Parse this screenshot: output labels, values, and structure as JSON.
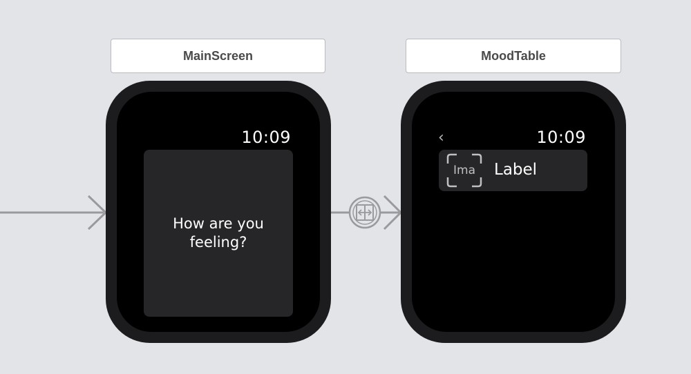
{
  "scenes": [
    {
      "title": "MainScreen",
      "time": "10:09",
      "greeting": "How are you feeling?"
    },
    {
      "title": "MoodTable",
      "time": "10:09",
      "back_icon": "chevron-left-icon",
      "back_glyph": "‹",
      "row": {
        "image_placeholder": "Ima",
        "label": "Label"
      }
    }
  ],
  "connections": {
    "entry_point_icon": "arrow-right-icon",
    "segue_icon": "relationship-segue-icon"
  },
  "colors": {
    "canvas": "#e3e4e8",
    "watch_bezel": "#1c1c1e",
    "screen": "#000000",
    "cell": "#262628",
    "connector": "#9a9a9c"
  }
}
